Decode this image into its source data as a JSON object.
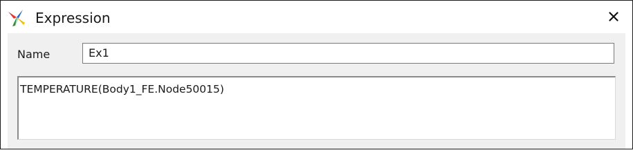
{
  "window": {
    "title": "Expression",
    "icon": "app-logo-icon",
    "close_icon": "close-icon"
  },
  "form": {
    "name_label": "Name",
    "name_value": "Ex1",
    "expression_text": "TEMPERATURE(Body1_FE.Node50015)"
  },
  "colors": {
    "client_background": "#f0f0f0",
    "field_border": "#7a7a7a",
    "text": "#1a1a1a"
  }
}
